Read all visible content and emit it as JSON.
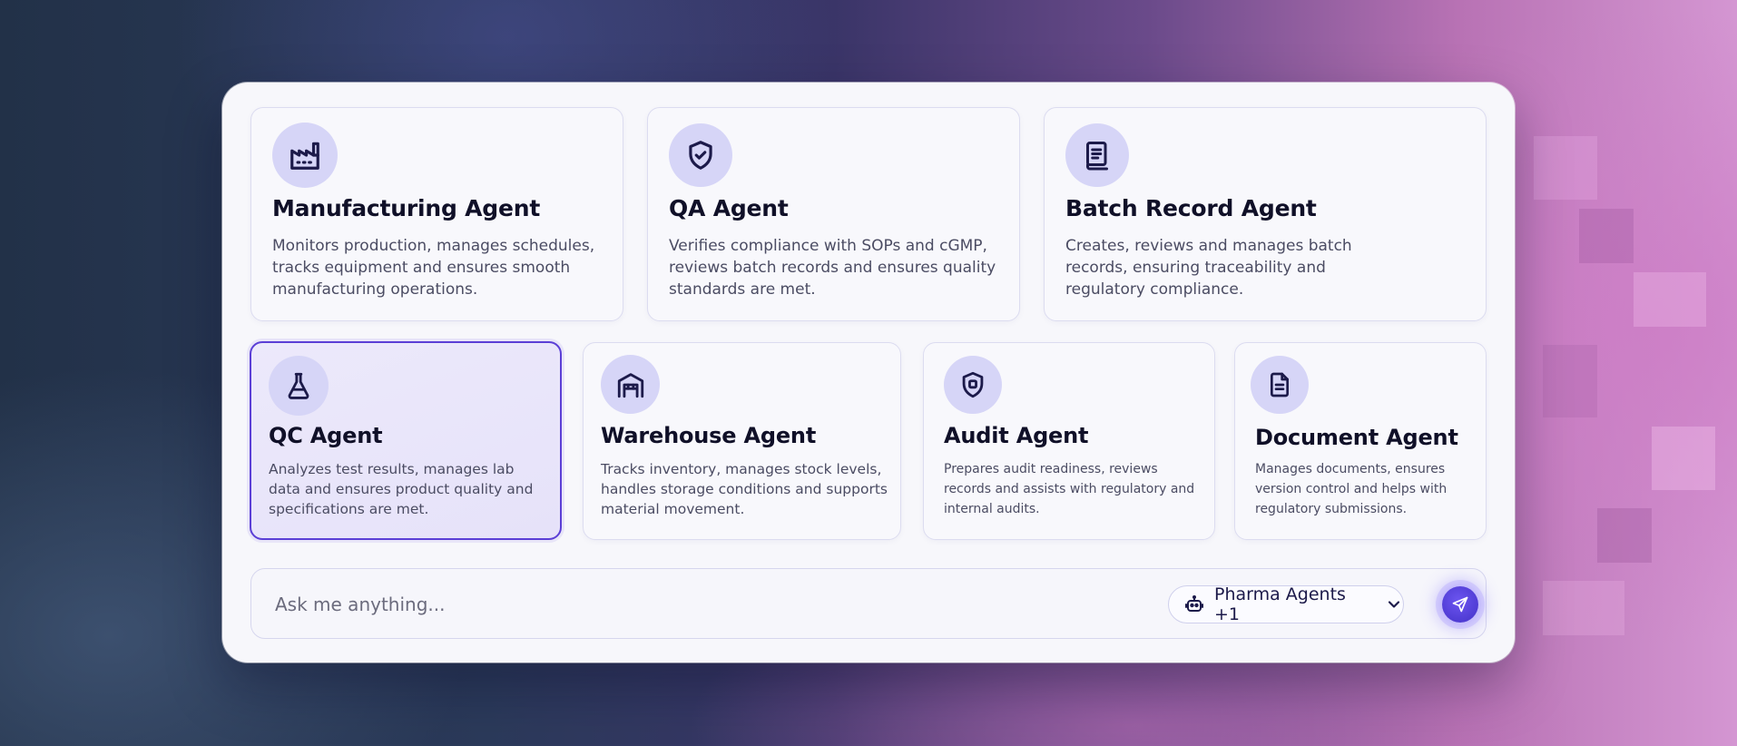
{
  "colors": {
    "accent": "#5b3fd6",
    "icon_bg": "#d6d5f7",
    "icon_stroke": "#1c1a4a",
    "title_text": "#101028",
    "body_text": "#4b4c63"
  },
  "agents": [
    {
      "id": "manufacturing",
      "icon": "factory-icon",
      "title": "Manufacturing Agent",
      "description": "Monitors production, manages schedules, tracks equipment and ensures smooth manufacturing operations.",
      "selected": false
    },
    {
      "id": "qa",
      "icon": "shield-check-icon",
      "title": "QA Agent",
      "description": "Verifies compliance with SOPs and cGMP, reviews batch records and ensures quality standards are met.",
      "selected": false
    },
    {
      "id": "batch-record",
      "icon": "record-book-icon",
      "title": "Batch Record Agent",
      "description": "Creates, reviews and manages batch records, ensuring traceability and regulatory compliance.",
      "selected": false
    },
    {
      "id": "qc",
      "icon": "flask-icon",
      "title": "QC Agent",
      "description": "Analyzes test results, manages lab data and ensures product quality and specifications are met.",
      "selected": true
    },
    {
      "id": "warehouse",
      "icon": "warehouse-icon",
      "title": "Warehouse Agent",
      "description": "Tracks inventory, manages stock levels, handles storage conditions and supports material movement.",
      "selected": false
    },
    {
      "id": "audit",
      "icon": "shield-badge-icon",
      "title": "Audit Agent",
      "description": "Prepares audit readiness, reviews records and assists with regulatory and internal audits.",
      "selected": false
    },
    {
      "id": "document",
      "icon": "document-icon",
      "title": "Document Agent",
      "description": "Manages documents, ensures version control and helps with regulatory submissions.",
      "selected": false
    }
  ],
  "chat": {
    "placeholder": "Ask me anything...",
    "agent_selector_label": "Pharma Agents +1",
    "agent_selector_icon": "robot-icon",
    "send_icon": "send-icon"
  }
}
